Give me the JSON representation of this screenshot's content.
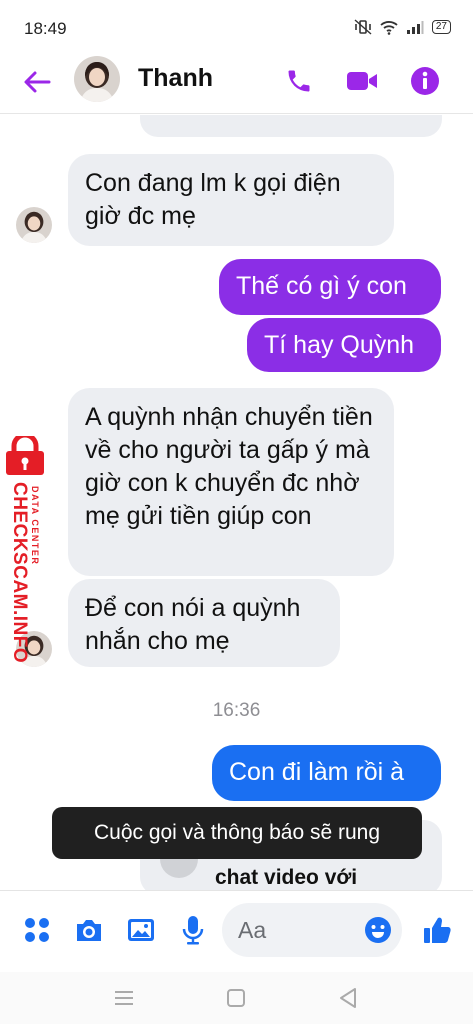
{
  "status_bar": {
    "time": "18:49",
    "battery": "27"
  },
  "header": {
    "contact_name": "Thanh"
  },
  "messages": [
    {
      "side": "in",
      "text": "Con đang lm k gọi điện giờ đc mẹ"
    },
    {
      "side": "out",
      "text": "Thế có gì ý con"
    },
    {
      "side": "out",
      "text": "Tí hay Quỳnh"
    },
    {
      "side": "in",
      "text": "A quỳnh nhận chuyển tiền về cho người ta gấp ý mà giờ con k chuyển đc nhờ mẹ gửi tiền giúp con"
    },
    {
      "side": "in",
      "text": "Để con nói a quỳnh nhắn cho mẹ"
    },
    {
      "side": "out",
      "text": "Con đi làm rồi à"
    }
  ],
  "timestamp": "16:36",
  "toast": {
    "text": "Cuộc gọi và thông báo sẽ rung"
  },
  "partial_card": {
    "text": "chat video với"
  },
  "composer": {
    "placeholder": "Aa"
  },
  "watermark": {
    "brand": "CHECKSCAM.INFO",
    "sub": "DATA CENTER"
  },
  "icons": {
    "back": "arrow-left-icon",
    "call": "phone-icon",
    "video": "video-camera-icon",
    "info": "info-icon",
    "menu": "four-dots-icon",
    "camera": "camera-icon",
    "gallery": "image-icon",
    "mic": "microphone-icon",
    "emoji": "smiley-icon",
    "like": "thumbs-up-icon"
  },
  "colors": {
    "accent_purple": "#8b2ee6",
    "accent_blue": "#1a6ff2",
    "incoming_bubble": "#eceef2",
    "watermark_red": "#e41e26"
  }
}
